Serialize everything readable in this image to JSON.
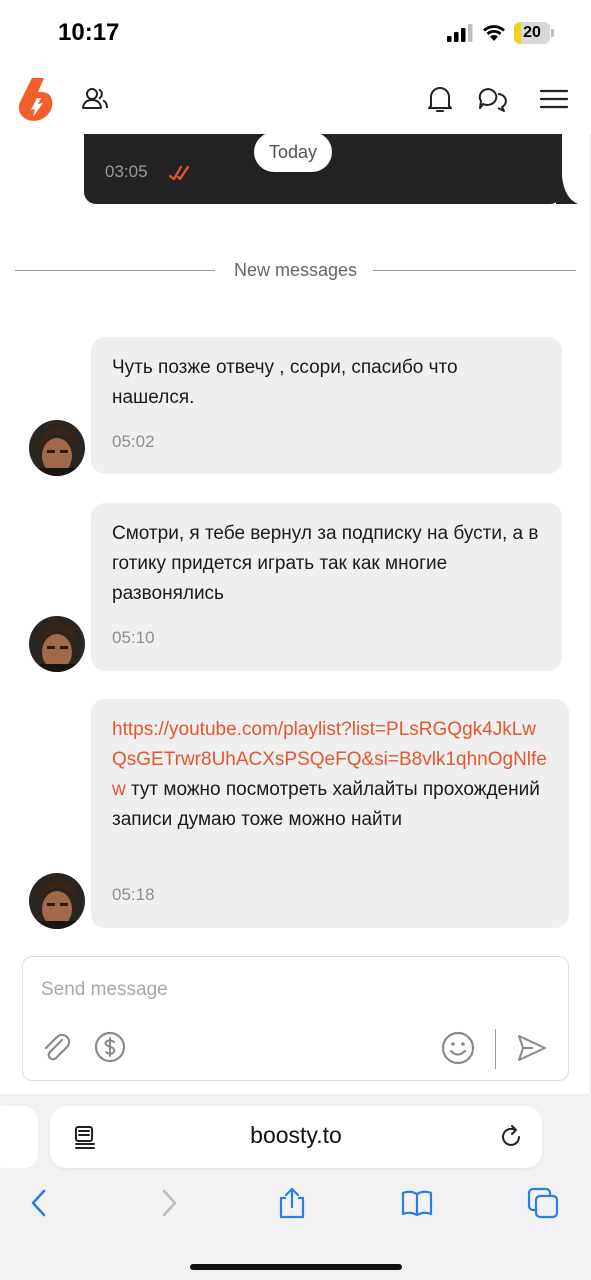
{
  "status_bar": {
    "time": "10:17",
    "battery": "20",
    "battery_level": 0.2
  },
  "header": {
    "logo": "boosty-logo",
    "icons": [
      "people-icon",
      "bell-icon",
      "chat-bubbles-icon",
      "hamburger-menu-icon"
    ]
  },
  "chat": {
    "previous_message": {
      "time": "03:05",
      "status": "read-checks-icon"
    },
    "date_pill": "Today",
    "divider_label": "New messages",
    "messages": [
      {
        "text": "Чуть позже отвечу , ссори, спасибо что нашелся.",
        "time": "05:02"
      },
      {
        "text": "Смотри, я тебе вернул за подписку на бусти, а в готику придется играть так как многие развонялись",
        "time": "05:10"
      },
      {
        "link": "https://youtube.com/playlist?list=PLsRGQgk4JkLwQsGETrwr8UhACXsPSQeFQ&si=B8vlk1qhnOgNlfew",
        "text": " тут можно посмотреть хайлайты прохождений записи думаю тоже можно найти",
        "time": "05:18"
      }
    ]
  },
  "composer": {
    "placeholder": "Send message",
    "icons": [
      "paperclip-icon",
      "dollar-icon",
      "emoji-icon",
      "send-icon"
    ]
  },
  "browser": {
    "url": "boosty.to",
    "nav_icons": [
      "back-icon",
      "forward-icon",
      "share-icon",
      "bookmarks-icon",
      "tabs-icon"
    ]
  },
  "colors": {
    "accent": "#e5572c",
    "bubble": "#efefef",
    "dark_bubble": "#232323"
  }
}
